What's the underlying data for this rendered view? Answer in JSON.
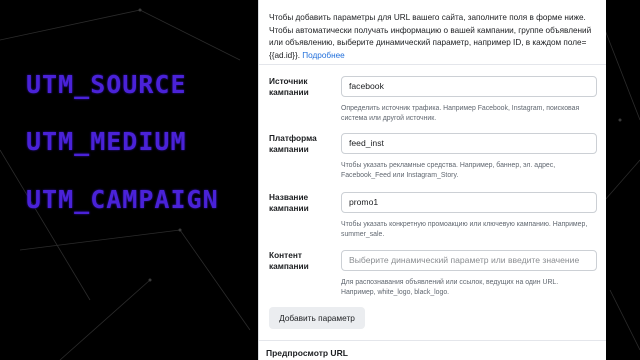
{
  "overlay": {
    "labels": [
      "UTM_SOURCE",
      "UTM_MEDIUM",
      "UTM_CAMPAIGN"
    ]
  },
  "form": {
    "intro": "Чтобы добавить параметры для URL вашего сайта, заполните поля в форме ниже. Чтобы автоматически получать информацию о вашей кампании, группе объявлений или объявлению, выберите динамический параметр, например ID, в каждом поле={{ad.id}}.",
    "more_link": "Подробнее",
    "fields": [
      {
        "label": "Источник кампании",
        "value": "facebook",
        "help": "Определить источник трафика. Например Facebook, Instagram, поисковая система или другой источник."
      },
      {
        "label": "Платформа кампании",
        "value": "feed_inst",
        "help": "Чтобы указать рекламные средства. Например, баннер, эл. адрес, Facebook_Feed или Instagram_Story."
      },
      {
        "label": "Название кампании",
        "value": "promo1",
        "help": "Чтобы указать конкретную промоакцию или ключевую кампанию. Например, summer_sale."
      },
      {
        "label": "Контент кампании",
        "value": "",
        "placeholder": "Выберите динамический параметр или введите значение",
        "help": "Для распознавания объявлений или ссылок, ведущих на один URL. Например, white_logo, black_logo."
      }
    ],
    "add_button": "Добавить параметр",
    "preview_title": "Предпросмотр URL"
  }
}
